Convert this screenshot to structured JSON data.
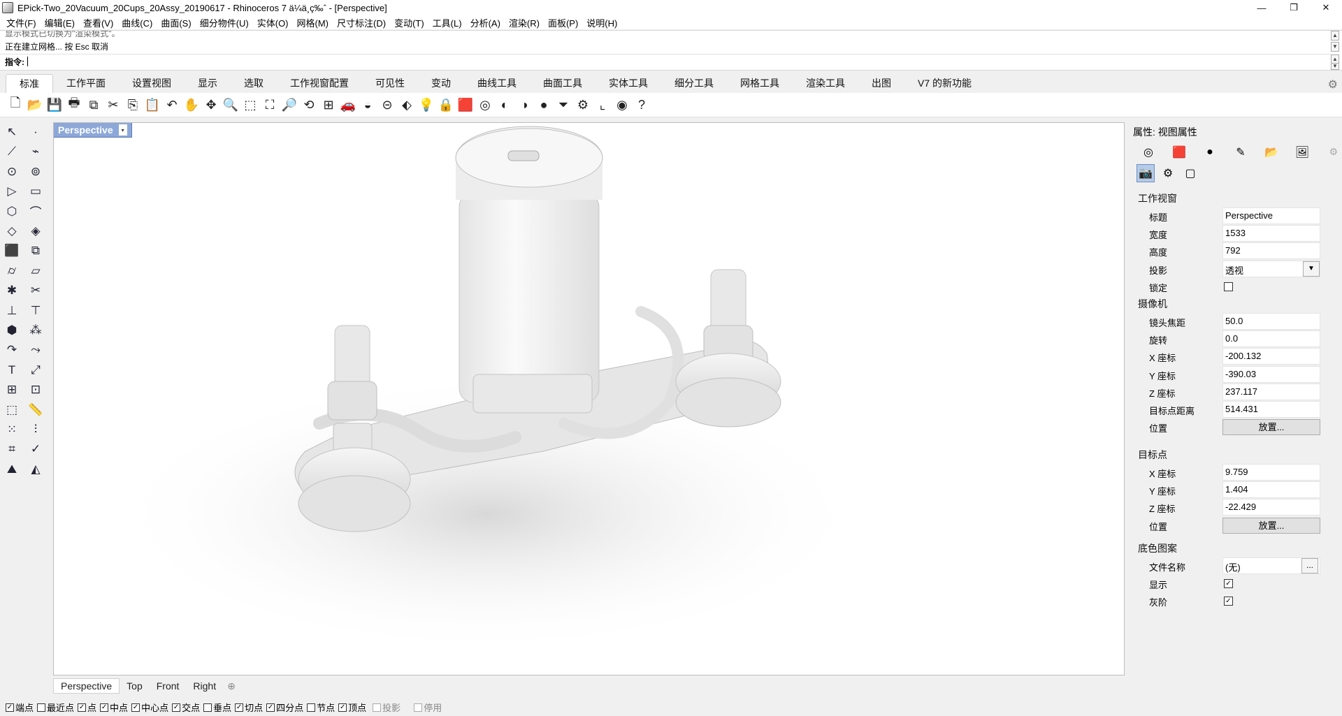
{
  "window": {
    "title": "EPick-Two_20Vacuum_20Cups_20Assy_20190617 - Rhinoceros 7 ä¼ä¸ç‰ˆ - [Perspective]",
    "controls": {
      "minimize": "—",
      "restore": "❐",
      "close": "✕"
    }
  },
  "menu": [
    "文件(F)",
    "编辑(E)",
    "查看(V)",
    "曲线(C)",
    "曲面(S)",
    "细分物件(U)",
    "实体(O)",
    "网格(M)",
    "尺寸标注(D)",
    "变动(T)",
    "工具(L)",
    "分析(A)",
    "渲染(R)",
    "面板(P)",
    "说明(H)"
  ],
  "command": {
    "history1": "显示模式已切换为\"渲染模式\"。",
    "history2": "正在建立网格... 按 Esc 取消",
    "prompt": "指令:",
    "scroll_up": "▲",
    "scroll_down": "▼"
  },
  "tabs": [
    "标准",
    "工作平面",
    "设置视图",
    "显示",
    "选取",
    "工作视窗配置",
    "可见性",
    "变动",
    "曲线工具",
    "曲面工具",
    "实体工具",
    "细分工具",
    "网格工具",
    "渲染工具",
    "出图",
    "V7 的新功能"
  ],
  "active_tab": "标准",
  "tab_settings_icon": "⚙",
  "toolbar_icons": [
    {
      "name": "new-icon",
      "glyph": "🗋"
    },
    {
      "name": "open-icon",
      "glyph": "📂"
    },
    {
      "name": "save-icon",
      "glyph": "💾"
    },
    {
      "name": "print-icon",
      "glyph": "🖶"
    },
    {
      "name": "export-icon",
      "glyph": "⧉"
    },
    {
      "name": "cut-icon",
      "glyph": "✂"
    },
    {
      "name": "copy-icon",
      "glyph": "⎘"
    },
    {
      "name": "paste-icon",
      "glyph": "📋"
    },
    {
      "name": "undo-icon",
      "glyph": "↶"
    },
    {
      "name": "pan-icon",
      "glyph": "✋"
    },
    {
      "name": "rotate-view-icon",
      "glyph": "✥"
    },
    {
      "name": "zoom-icon",
      "glyph": "🔍"
    },
    {
      "name": "zoom-window-icon",
      "glyph": "⬚"
    },
    {
      "name": "zoom-extents-icon",
      "glyph": "⛶"
    },
    {
      "name": "zoom-selected-icon",
      "glyph": "🔎"
    },
    {
      "name": "undo-view-icon",
      "glyph": "⟲"
    },
    {
      "name": "viewport-layout-icon",
      "glyph": "⊞"
    },
    {
      "name": "car-icon",
      "glyph": "🚗"
    },
    {
      "name": "shaded-icon",
      "glyph": "◒"
    },
    {
      "name": "cplane-icon",
      "glyph": "⊝"
    },
    {
      "name": "select-icon",
      "glyph": "⬖"
    },
    {
      "name": "light-icon",
      "glyph": "💡"
    },
    {
      "name": "lock-icon",
      "glyph": "🔒"
    },
    {
      "name": "layer-icon",
      "glyph": "🟥"
    },
    {
      "name": "color-icon",
      "glyph": "◎"
    },
    {
      "name": "material-icon",
      "glyph": "◐"
    },
    {
      "name": "render-preview-icon",
      "glyph": "◑"
    },
    {
      "name": "sphere-icon",
      "glyph": "●"
    },
    {
      "name": "filter-icon",
      "glyph": "⏷"
    },
    {
      "name": "options-icon",
      "glyph": "⚙"
    },
    {
      "name": "snap-icon",
      "glyph": "⌞"
    },
    {
      "name": "grasshopper-icon",
      "glyph": "◉"
    },
    {
      "name": "help-icon",
      "glyph": "?"
    }
  ],
  "left_toolbar_icons": [
    {
      "name": "select-arrow-icon",
      "glyph": "↖"
    },
    {
      "name": "point-icon",
      "glyph": "·"
    },
    {
      "name": "polyline-icon",
      "glyph": "⟋"
    },
    {
      "name": "curve-icon",
      "glyph": "⌁"
    },
    {
      "name": "circle-icon",
      "glyph": "⊙"
    },
    {
      "name": "ellipse-icon",
      "glyph": "⊚"
    },
    {
      "name": "triangle-icon",
      "glyph": "▷"
    },
    {
      "name": "rectangle-icon",
      "glyph": "▭"
    },
    {
      "name": "polygon-icon",
      "glyph": "⬡"
    },
    {
      "name": "fillet-icon",
      "glyph": "⌒"
    },
    {
      "name": "surface-icon",
      "glyph": "◇"
    },
    {
      "name": "loft-icon",
      "glyph": "◈"
    },
    {
      "name": "box-icon",
      "glyph": "⬛"
    },
    {
      "name": "boolean-icon",
      "glyph": "⧉"
    },
    {
      "name": "cylinder-icon",
      "glyph": "⌭"
    },
    {
      "name": "plane-icon",
      "glyph": "▱"
    },
    {
      "name": "explode-icon",
      "glyph": "✱"
    },
    {
      "name": "trim-icon",
      "glyph": "✂"
    },
    {
      "name": "split-icon",
      "glyph": "⊥"
    },
    {
      "name": "join-icon",
      "glyph": "⊤"
    },
    {
      "name": "mesh-icon",
      "glyph": "⬢"
    },
    {
      "name": "points-icon",
      "glyph": "⁂"
    },
    {
      "name": "arc-icon",
      "glyph": "↷"
    },
    {
      "name": "offset-icon",
      "glyph": "⤳"
    },
    {
      "name": "text-icon",
      "glyph": "T"
    },
    {
      "name": "dim-icon",
      "glyph": "⤢"
    },
    {
      "name": "group-icon",
      "glyph": "⊞"
    },
    {
      "name": "block-icon",
      "glyph": "⊡"
    },
    {
      "name": "solid-box-icon",
      "glyph": "⬚"
    },
    {
      "name": "ruler-icon",
      "glyph": "📏"
    },
    {
      "name": "array-icon",
      "glyph": "⁙"
    },
    {
      "name": "align-icon",
      "glyph": "⫶"
    },
    {
      "name": "analyze-icon",
      "glyph": "⌗"
    },
    {
      "name": "check-icon",
      "glyph": "✓"
    },
    {
      "name": "render-icon",
      "glyph": "⛰"
    },
    {
      "name": "paint-icon",
      "glyph": "◭"
    }
  ],
  "viewport": {
    "label": "Perspective",
    "dropdown": "▾"
  },
  "viewport_tabs": [
    "Perspective",
    "Top",
    "Front",
    "Right"
  ],
  "viewport_tab_add": "⊕",
  "snaps": [
    {
      "label": "端点",
      "checked": true
    },
    {
      "label": "最近点",
      "checked": false
    },
    {
      "label": "点",
      "checked": true
    },
    {
      "label": "中点",
      "checked": true
    },
    {
      "label": "中心点",
      "checked": true
    },
    {
      "label": "交点",
      "checked": true
    },
    {
      "label": "垂点",
      "checked": false
    },
    {
      "label": "切点",
      "checked": true
    },
    {
      "label": "四分点",
      "checked": true
    },
    {
      "label": "节点",
      "checked": false
    },
    {
      "label": "顶点",
      "checked": true
    },
    {
      "label": "投影",
      "checked": false,
      "disabled": true
    },
    {
      "label": "停用",
      "checked": false,
      "disabled": true
    }
  ],
  "panel": {
    "title": "属性: 视图属性",
    "icons": [
      "◎",
      "🟥",
      "●",
      "✎",
      "📂",
      "🖼"
    ],
    "sub_icons": [
      "📷",
      "⚙",
      "▢"
    ],
    "settings_icon": "⚙",
    "viewport_section": "工作视窗",
    "rows_viewport": [
      {
        "label": "标题",
        "value": "Perspective"
      },
      {
        "label": "宽度",
        "value": "1533"
      },
      {
        "label": "高度",
        "value": "792"
      },
      {
        "label": "投影",
        "value": "透视",
        "dropdown": "▼"
      },
      {
        "label": "锁定",
        "checkbox": ""
      }
    ],
    "camera_section": "摄像机",
    "rows_camera": [
      {
        "label": "镜头焦距",
        "value": "50.0"
      },
      {
        "label": "旋转",
        "value": "0.0"
      },
      {
        "label": "X 座标",
        "value": "-200.132"
      },
      {
        "label": "Y 座标",
        "value": "-390.03"
      },
      {
        "label": "Z 座标",
        "value": "237.117"
      },
      {
        "label": "目标点距离",
        "value": "514.431"
      },
      {
        "label": "位置",
        "button": "放置..."
      }
    ],
    "target_section": "目标点",
    "rows_target": [
      {
        "label": "X 座标",
        "value": "9.759"
      },
      {
        "label": "Y 座标",
        "value": "1.404"
      },
      {
        "label": "Z 座标",
        "value": "-22.429"
      },
      {
        "label": "位置",
        "button": "放置..."
      }
    ],
    "wallpaper_section": "底色图案",
    "rows_wallpaper": [
      {
        "label": "文件名称",
        "value": "(无)",
        "browse": "..."
      },
      {
        "label": "显示",
        "checkbox": "✓"
      },
      {
        "label": "灰阶",
        "checkbox": "✓"
      }
    ]
  }
}
